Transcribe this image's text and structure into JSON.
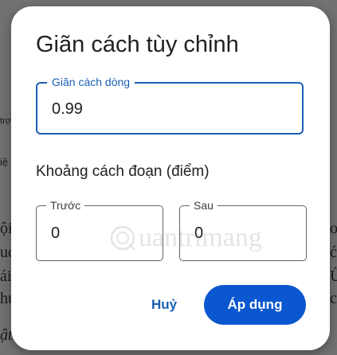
{
  "dialog": {
    "title": "Giãn cách tùy chỉnh",
    "line_spacing": {
      "label": "Giãn cách dòng",
      "value": "0.99"
    },
    "paragraph_spacing": {
      "section_label": "Khoảng cách đoạn (điểm)",
      "before": {
        "label": "Trước",
        "value": "0"
      },
      "after": {
        "label": "Sau",
        "value": "0"
      }
    },
    "cancel_label": "Huỷ",
    "apply_label": "Áp dụng"
  },
  "background": {
    "fragments": [
      "trợ",
      "iệ",
      "ội",
      "uc",
      "ái",
      "hư",
      "ật",
      "o",
      "ć",
      "Ű",
      "c"
    ]
  },
  "watermark": {
    "text": "uantrimang",
    "icon": "watermark-logo-icon"
  },
  "colors": {
    "accent": "#1a5fb4",
    "apply_button": "#0b57d0",
    "dialog_background": "#ffffff",
    "scrim": "#727272"
  }
}
